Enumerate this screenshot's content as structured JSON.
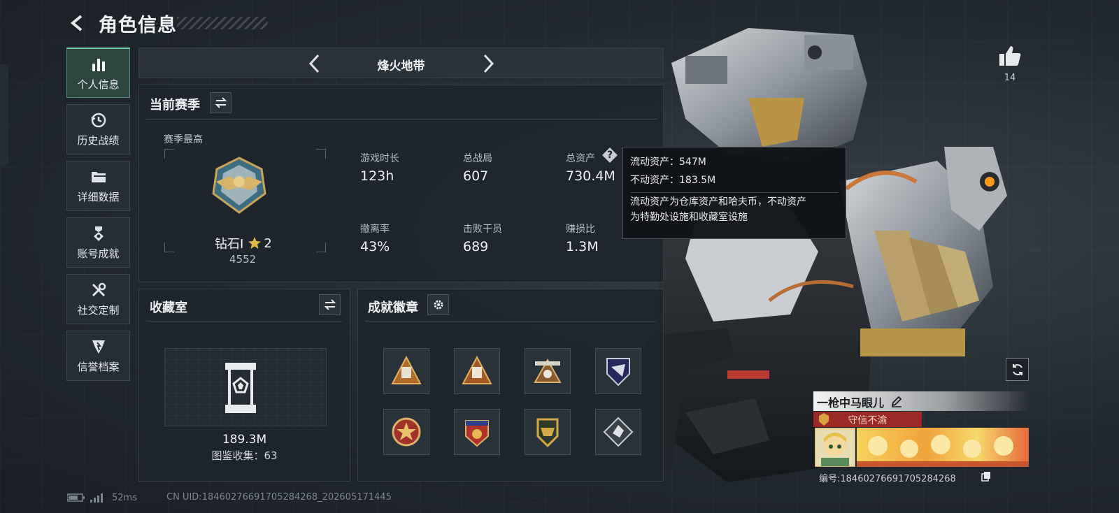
{
  "header": {
    "title": "角色信息"
  },
  "sidebar": {
    "items": [
      {
        "label": "个人信息",
        "icon": "bar-chart-icon",
        "active": true
      },
      {
        "label": "历史战绩",
        "icon": "history-icon"
      },
      {
        "label": "详细数据",
        "icon": "folder-icon"
      },
      {
        "label": "账号成就",
        "icon": "achievement-icon"
      },
      {
        "label": "社交定制",
        "icon": "tools-icon"
      },
      {
        "label": "信誉档案",
        "icon": "credit-icon"
      }
    ]
  },
  "season_nav": {
    "name": "烽火地带"
  },
  "current_season": {
    "title": "当前赛季",
    "best_label": "赛季最高",
    "rank_name": "钻石Ⅰ",
    "rank_stars": "2",
    "rank_score": "4552",
    "stats": [
      {
        "label": "游戏时长",
        "value": "123h"
      },
      {
        "label": "总战局",
        "value": "607"
      },
      {
        "label": "总资产",
        "value": "730.4M"
      },
      {
        "label": "撤离率",
        "value": "43%"
      },
      {
        "label": "击败干员",
        "value": "689"
      },
      {
        "label": "赚损比",
        "value": "1.3M"
      }
    ]
  },
  "tooltip": {
    "liquid": "流动资产：547M",
    "fixed": "不动资产：183.5M",
    "desc_line1": "流动资产为仓库资产和哈夫币，不动资产",
    "desc_line2": "为特勤处设施和收藏室设施"
  },
  "collection": {
    "title": "收藏室",
    "value": "189.3M",
    "count_label": "图鉴收集：63"
  },
  "badges": {
    "title": "成就徽章",
    "items": [
      "badge-1-icon",
      "badge-2-icon",
      "badge-3-icon",
      "badge-4-icon",
      "badge-5-icon",
      "badge-6-icon",
      "badge-7-icon",
      "badge-8-icon"
    ]
  },
  "likes": {
    "count": "14"
  },
  "player": {
    "name": "一枪中马眼儿",
    "title": "守信不渝",
    "id_text": "编号:18460276691705284268"
  },
  "status": {
    "ping": "52ms",
    "uid": "CN UID:18460276691705284268_202605171445"
  },
  "colors": {
    "accent": "#6fd0b0",
    "title_bar": "#9b2a27",
    "gold": "#d9a53a"
  }
}
